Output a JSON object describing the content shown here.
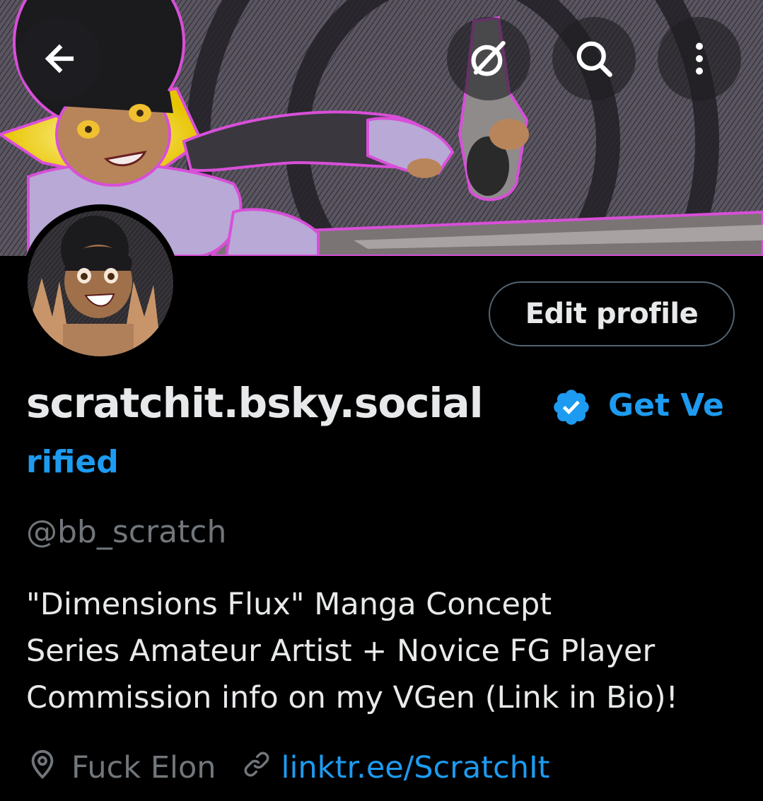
{
  "header": {
    "back_icon": "arrow-left-icon",
    "grok_icon": "grok-icon",
    "search_icon": "search-icon",
    "more_icon": "more-vertical-icon"
  },
  "profile": {
    "display_name": "scratchit.bsky.social",
    "get_verified_part1": "Get Ve",
    "get_verified_part2": "rified",
    "handle": "@bb_scratch",
    "bio_lines": [
      "\"Dimensions Flux\" Manga Concept",
      "Series Amateur Artist + Novice FG Player",
      "Commission info on my VGen (Link in Bio)!"
    ],
    "location": "Fuck Elon",
    "link": "linktr.ee/ScratchIt"
  },
  "actions": {
    "edit_profile_label": "Edit profile"
  },
  "colors": {
    "background": "#000000",
    "text_primary": "#e7e9ea",
    "text_secondary": "#71767b",
    "accent": "#1d9bf0",
    "button_border": "#536471"
  }
}
